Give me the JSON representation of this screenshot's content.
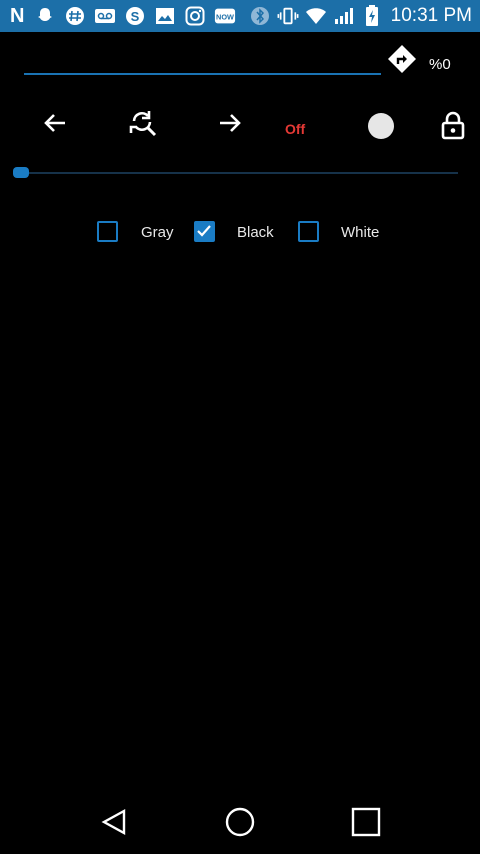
{
  "status_bar": {
    "time": "10:31 PM",
    "brand": "N",
    "left_icons": [
      "n-logo-icon",
      "snapchat-icon",
      "hashtag-icon",
      "voicemail-icon",
      "skype-icon",
      "gallery-icon",
      "instagram-icon",
      "now-icon"
    ],
    "right_icons": [
      "bluetooth-icon",
      "vibrate-icon",
      "wifi-icon",
      "signal-icon",
      "battery-charging-icon"
    ]
  },
  "toolbar": {
    "progress_label": "%0",
    "off_label": "Off"
  },
  "slider": {
    "value": 0
  },
  "checkboxes": [
    {
      "label": "Gray",
      "checked": false
    },
    {
      "label": "Black",
      "checked": true
    },
    {
      "label": "White",
      "checked": false
    }
  ],
  "colors": {
    "status_bar_bg": "#1c6fa8",
    "accent": "#1a7cc4",
    "off_red": "#e53935",
    "background": "#000000"
  }
}
